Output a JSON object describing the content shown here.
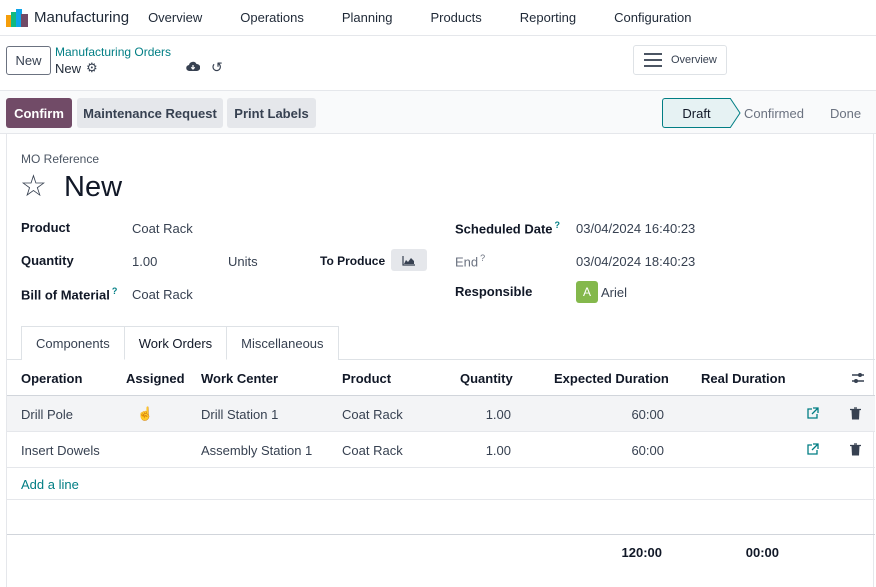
{
  "navbar": {
    "app_name": "Manufacturing",
    "menu": [
      "Overview",
      "Operations",
      "Planning",
      "Products",
      "Reporting",
      "Configuration"
    ]
  },
  "control": {
    "new_button": "New",
    "breadcrumb_parent": "Manufacturing Orders",
    "breadcrumb_current": "New",
    "overview_button": "Overview"
  },
  "statusbar": {
    "buttons": [
      "Confirm",
      "Maintenance Request",
      "Print Labels"
    ],
    "stages": [
      "Draft",
      "Confirmed",
      "Done"
    ],
    "active_stage": "Draft"
  },
  "form": {
    "mo_reference_label": "MO Reference",
    "title": "New",
    "product_label": "Product",
    "product_value": "Coat Rack",
    "quantity_label": "Quantity",
    "quantity_value": "1.00",
    "quantity_uom": "Units",
    "to_produce_label": "To Produce",
    "bom_label": "Bill of Material",
    "bom_value": "Coat Rack",
    "scheduled_date_label": "Scheduled Date",
    "scheduled_date_value": "03/04/2024 16:40:23",
    "end_label": "End",
    "end_value": "03/04/2024 18:40:23",
    "responsible_label": "Responsible",
    "responsible_initial": "A",
    "responsible_value": "Ariel",
    "help_mark": "?"
  },
  "tabs": [
    {
      "label": "Components",
      "active": false
    },
    {
      "label": "Work Orders",
      "active": true
    },
    {
      "label": "Miscellaneous",
      "active": false
    }
  ],
  "work_orders": {
    "columns": [
      "Operation",
      "Assigned",
      "Work Center",
      "Product",
      "Quantity",
      "Expected Duration",
      "Real Duration"
    ],
    "rows": [
      {
        "operation": "Drill Pole",
        "assigned": "",
        "work_center": "Drill Station 1",
        "product": "Coat Rack",
        "quantity": "1.00",
        "expected_duration": "60:00",
        "real_duration": ""
      },
      {
        "operation": "Insert Dowels",
        "assigned": "",
        "work_center": "Assembly Station 1",
        "product": "Coat Rack",
        "quantity": "1.00",
        "expected_duration": "60:00",
        "real_duration": ""
      }
    ],
    "add_line": "Add a line",
    "total_expected": "120:00",
    "total_real": "00:00"
  },
  "colors": {
    "brand": "#714b67",
    "accent": "#017e84",
    "avatar": "#84b84c"
  }
}
